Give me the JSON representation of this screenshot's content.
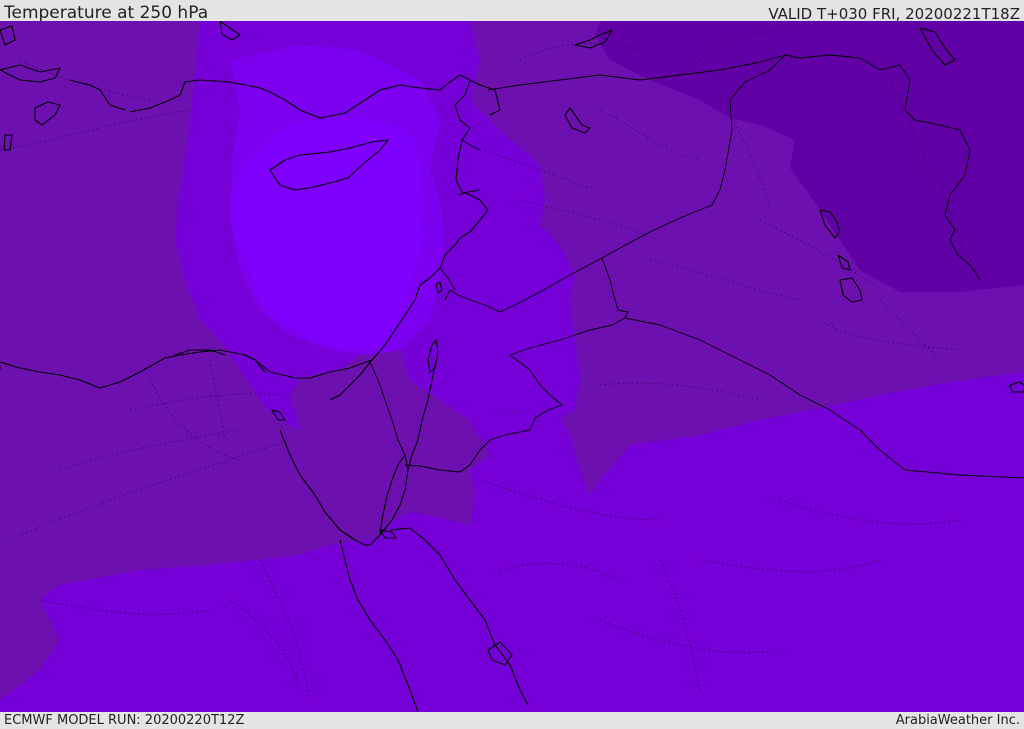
{
  "header": {
    "title": "Temperature at 250 hPa",
    "valid": "VALID T+030 FRI, 20200221T18Z"
  },
  "footer": {
    "model_run": "ECMWF MODEL RUN: 20200220T12Z",
    "credit": "ArabiaWeather Inc."
  },
  "colors": {
    "bands": {
      "darkest": "#6000a6",
      "dark": "#6d10b0",
      "medium": "#7500d8",
      "light": "#7d00f0",
      "brightest": "#8000ff"
    },
    "coastline": "#000000",
    "border": "#000000",
    "frame": "#e4e4e4"
  }
}
